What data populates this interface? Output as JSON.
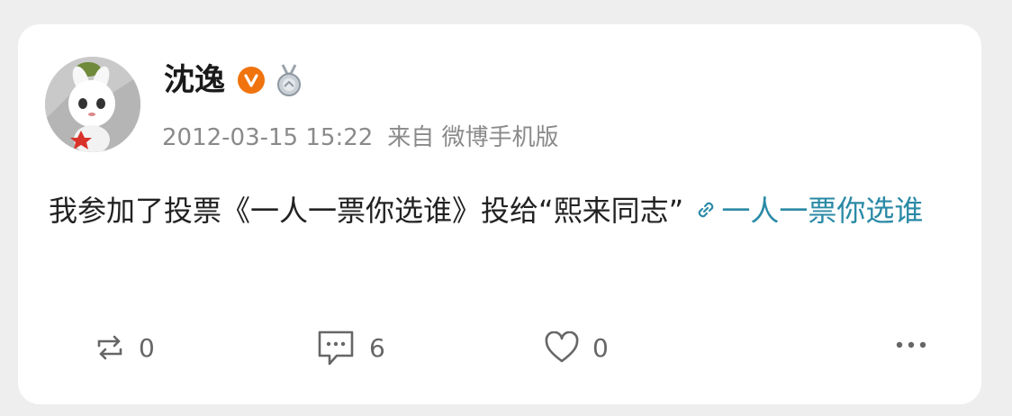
{
  "post": {
    "author": {
      "name": "沈逸",
      "avatar_icon": "white-rabbit-mascot-avatar",
      "verified_icon": "orange-v-verified-badge",
      "medal_icon": "silver-medal-icon"
    },
    "timestamp": "2012-03-15 15:22",
    "source": "来自 微博手机版",
    "text": "我参加了投票《一人一票你选谁》投给“熙来同志”",
    "link": {
      "icon": "link-icon",
      "text": "一人一票你选谁"
    },
    "actions": {
      "repost_count": "0",
      "comment_count": "6",
      "like_count": "0"
    }
  },
  "colors": {
    "background": "#eeeeee",
    "card": "#ffffff",
    "link": "#2a8aa6",
    "verified_badge": "#f0730e",
    "meta_text": "#8a8a8a"
  }
}
